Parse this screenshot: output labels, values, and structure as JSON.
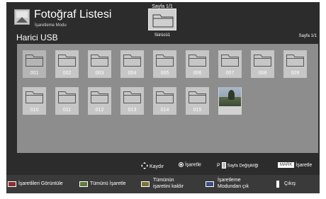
{
  "header": {
    "title": "Fotoğraf Listesi",
    "subtitle": "İşaretleme Modu",
    "device": "Harici USB",
    "page_top": "Sayfa 1/1",
    "drive_label": "Sürücü1",
    "page_right": "Sayfa 1/1"
  },
  "items": [
    {
      "label": "001",
      "type": "folder"
    },
    {
      "label": "002",
      "type": "folder"
    },
    {
      "label": "003",
      "type": "folder"
    },
    {
      "label": "004",
      "type": "folder"
    },
    {
      "label": "005",
      "type": "folder"
    },
    {
      "label": "006",
      "type": "folder"
    },
    {
      "label": "007",
      "type": "folder"
    },
    {
      "label": "008",
      "type": "folder"
    },
    {
      "label": "009",
      "type": "folder"
    },
    {
      "label": "010",
      "type": "folder"
    },
    {
      "label": "011",
      "type": "folder"
    },
    {
      "label": "012",
      "type": "folder"
    },
    {
      "label": "013",
      "type": "folder"
    },
    {
      "label": "014",
      "type": "folder"
    },
    {
      "label": "015",
      "type": "folder"
    },
    {
      "label": "",
      "type": "photo"
    }
  ],
  "help": {
    "scroll": "Kaydır",
    "mark": "İşaretle",
    "page_key": "P",
    "page_change": "Sayfa Değişikliği",
    "mark_key": "MARK",
    "mark2": "İşaretle"
  },
  "bottom": {
    "b1": "İşaretlileri Görüntüle",
    "b2": "Tümünü İşaretle",
    "b3_l1": "Tümünün",
    "b3_l2": "işaretini kaldır",
    "b4_l1": "İşaretleme",
    "b4_l2": "Modundan çık",
    "b5": "Çıkış",
    "colors": {
      "red": "#8a2f2f",
      "green": "#5f7a3c",
      "yellow": "#7a7438",
      "blue": "#3d4f80"
    }
  }
}
